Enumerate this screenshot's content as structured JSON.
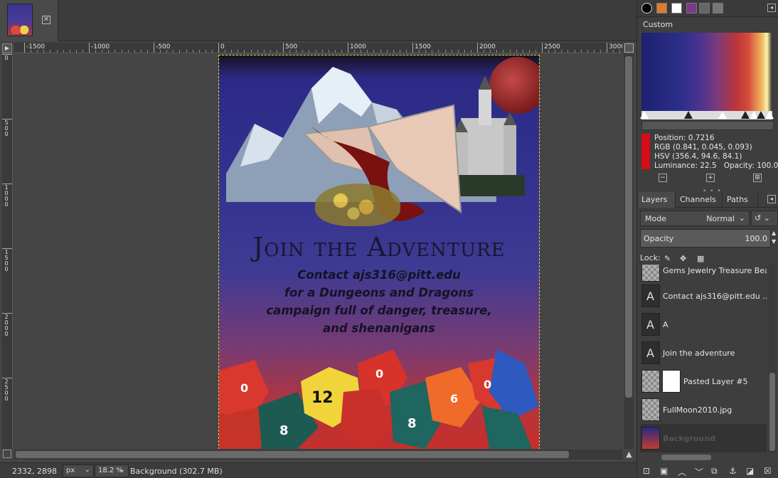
{
  "status": {
    "coords": "2332, 2898",
    "unit": "px",
    "zoom": "18.2 %",
    "layer_info": "Background (302.7 MB)"
  },
  "rulers": {
    "h_labels": [
      "-1500",
      "-1000",
      "-500",
      "0",
      "500",
      "1000",
      "1500",
      "2000",
      "2500",
      "3000"
    ],
    "v_labels": [
      "0",
      "500",
      "1000",
      "1500",
      "2000",
      "2500"
    ]
  },
  "poster": {
    "title": "Join the Adventure",
    "body_lines": [
      "Contact ajs316@pitt.edu",
      "for a Dungeons and Dragons",
      "campaign full of danger, treasure,",
      "and shenanigans"
    ]
  },
  "gradient_editor": {
    "name": "Custom",
    "position": "Position: 0.7216",
    "rgb": "RGB (0.841, 0.045, 0.093)",
    "hsv": "HSV (356.4, 94.6, 84.1)",
    "luminance": "Luminance: 22.5",
    "opacity": "Opacity: 100.0",
    "swatch_color": "#d60c18"
  },
  "layers_panel": {
    "tabs": [
      "Layers",
      "Channels",
      "Paths"
    ],
    "mode_label": "Mode",
    "mode_value": "Normal",
    "opacity_label": "Opacity",
    "opacity_value": "100.0",
    "lock_label": "Lock:",
    "layers": [
      {
        "name": "Gems Jewelry Treasure Beads",
        "type": "image"
      },
      {
        "name": "Contact ajs316@pitt.edu ...",
        "type": "text"
      },
      {
        "name": "A",
        "type": "text"
      },
      {
        "name": "Join the adventure",
        "type": "text"
      },
      {
        "name": "Pasted Layer #5",
        "type": "image-mask"
      },
      {
        "name": "FullMoon2010.jpg",
        "type": "image"
      },
      {
        "name": "Background",
        "type": "gradient"
      }
    ]
  }
}
